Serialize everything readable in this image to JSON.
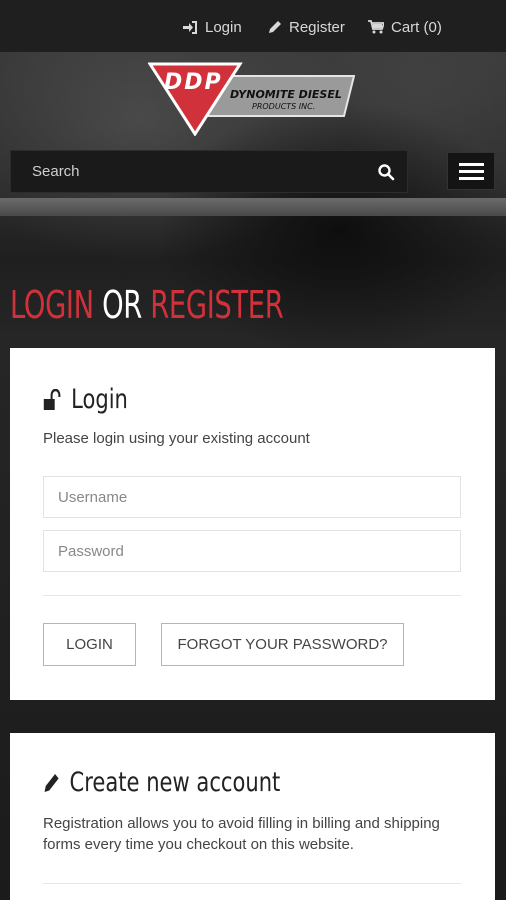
{
  "colors": {
    "accent_red": "#d1313a",
    "card_bg": "#ffffff",
    "topbar_bg": "#1f1f1f"
  },
  "topbar": {
    "login": {
      "label": "Login",
      "icon": "sign-in-icon"
    },
    "register": {
      "label": "Register",
      "icon": "pencil-icon"
    },
    "cart": {
      "label": "Cart (0)",
      "icon": "cart-icon"
    }
  },
  "logo": {
    "letters": "DDP",
    "line1": "DYNOMITE DIESEL",
    "line2": "PRODUCTS INC."
  },
  "search": {
    "placeholder": "Search",
    "icon": "search-icon"
  },
  "menu": {
    "icon": "hamburger-menu-icon"
  },
  "page": {
    "title_part1": "LOGIN",
    "title_part2": "OR",
    "title_part3": "REGISTER"
  },
  "login_card": {
    "title": "Login",
    "icon": "unlock-icon",
    "subtitle": "Please login using your existing account",
    "username_placeholder": "Username",
    "password_placeholder": "Password",
    "login_button": "LOGIN",
    "forgot_button": "FORGOT YOUR PASSWORD?"
  },
  "register_card": {
    "title": "Create new account",
    "icon": "pencil-icon",
    "description": "Registration allows you to avoid filling in billing and shipping forms every time you checkout on this website."
  }
}
